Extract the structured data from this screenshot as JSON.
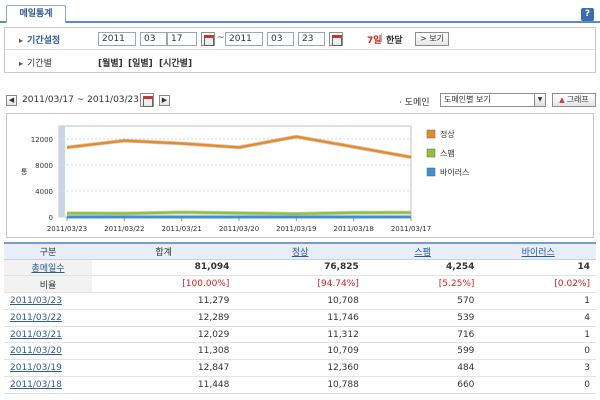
{
  "tab": {
    "title": "메일통계",
    "help_icon": "?"
  },
  "filter": {
    "period_label": "기간설정",
    "start": {
      "year": "2011",
      "month": "03",
      "day": "17"
    },
    "end": {
      "year": "2011",
      "month": "03",
      "day": "23"
    },
    "range_sep": "~",
    "quick_7day": "7일",
    "quick_sep": "|",
    "quick_month": "한달",
    "view_button": "> 보기",
    "unit_label": "기간별",
    "unit_monthly": "[월별]",
    "unit_daily": "[일별]",
    "unit_hourly": "[시간별]"
  },
  "nav": {
    "prev": "◀",
    "next": "▶",
    "range": "2011/03/17 ~ 2011/03/23",
    "domain_label": "· 도메인",
    "domain_select": "도메인별 보기",
    "graph_button": "그래프"
  },
  "chart_data": {
    "type": "line",
    "categories": [
      "2011/03/23",
      "2011/03/22",
      "2011/03/21",
      "2011/03/20",
      "2011/03/19",
      "2011/03/18",
      "2011/03/17"
    ],
    "ylim": [
      0,
      14000
    ],
    "yticks": [
      "12000",
      "8000",
      "4000",
      "0"
    ],
    "ylabel": "통",
    "series": [
      {
        "name": "정상",
        "color": "#e98a1f",
        "values": [
          10708,
          11746,
          11312,
          10709,
          12360,
          10788,
          9202
        ]
      },
      {
        "name": "스팸",
        "color": "#8fc23c",
        "values": [
          570,
          539,
          716,
          599,
          484,
          660,
          686
        ]
      },
      {
        "name": "바이러스",
        "color": "#3a8fd6",
        "values": [
          1,
          4,
          1,
          0,
          3,
          0,
          5
        ]
      }
    ]
  },
  "table": {
    "headers": [
      "구분",
      "합계",
      "정상",
      "스팸",
      "바이러스"
    ],
    "total_label": "총메일수",
    "total": [
      "81,094",
      "76,825",
      "4,254",
      "14"
    ],
    "ratio_label": "비율",
    "ratio": [
      "[100.00%]",
      "[94.74%]",
      "[5.25%]",
      "[0.02%]"
    ],
    "rows": [
      {
        "date": "2011/03/23",
        "sum": "11,279",
        "normal": "10,708",
        "spam": "570",
        "virus": "1"
      },
      {
        "date": "2011/03/22",
        "sum": "12,289",
        "normal": "11,746",
        "spam": "539",
        "virus": "4"
      },
      {
        "date": "2011/03/21",
        "sum": "12,029",
        "normal": "11,312",
        "spam": "716",
        "virus": "1"
      },
      {
        "date": "2011/03/20",
        "sum": "11,308",
        "normal": "10,709",
        "spam": "599",
        "virus": "0"
      },
      {
        "date": "2011/03/19",
        "sum": "12,847",
        "normal": "12,360",
        "spam": "484",
        "virus": "3"
      },
      {
        "date": "2011/03/18",
        "sum": "11,448",
        "normal": "10,788",
        "spam": "660",
        "virus": "0"
      }
    ]
  }
}
